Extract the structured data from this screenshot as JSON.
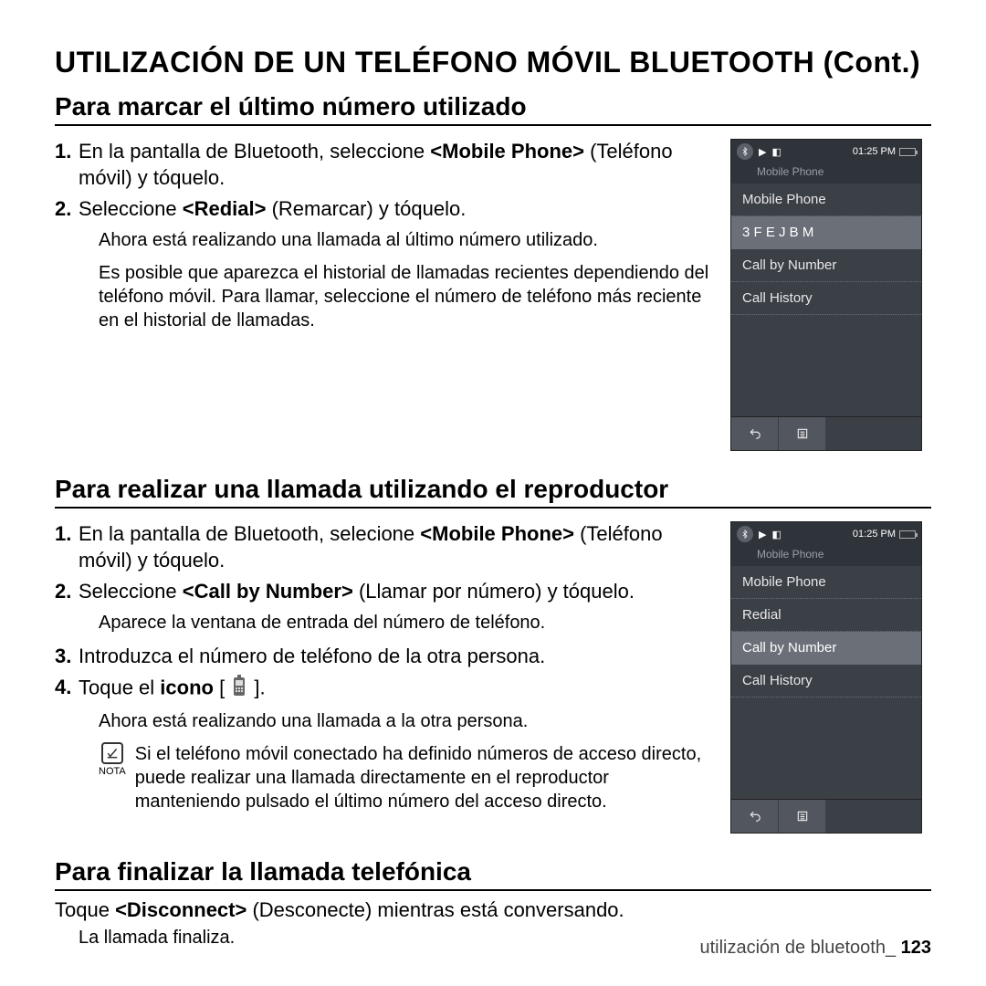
{
  "title": "UTILIZACIÓN DE UN TELÉFONO MÓVIL BLUETOOTH (Cont.)",
  "section1": {
    "heading": "Para marcar el último número utilizado",
    "step1_num": "1.",
    "step1_a": "En la pantalla de Bluetooth, seleccione ",
    "step1_b": "<Mobile Phone>",
    "step1_c": " (Teléfono móvil) y tóquelo.",
    "step2_num": "2.",
    "step2_a": "Seleccione ",
    "step2_b": "<Redial>",
    "step2_c": " (Remarcar) y tóquelo.",
    "sub1": "Ahora está realizando una llamada al último número utilizado.",
    "sub2": "Es posible que aparezca el historial de llamadas recientes dependiendo del teléfono móvil. Para llamar, seleccione el número de teléfono más reciente en el historial de llamadas."
  },
  "section2": {
    "heading": "Para realizar una llamada utilizando el reproductor",
    "step1_num": "1.",
    "step1_a": "En la pantalla de Bluetooth, selecione ",
    "step1_b": "<Mobile Phone>",
    "step1_c": " (Teléfono móvil) y tóquelo.",
    "step2_num": "2.",
    "step2_a": "Seleccione ",
    "step2_b": "<Call by Number>",
    "step2_c": " (Llamar por número) y tóquelo.",
    "sub1": "Aparece la ventana de entrada del número de teléfono.",
    "step3_num": "3.",
    "step3": "Introduzca el número de teléfono de la otra persona.",
    "step4_num": "4.",
    "step4_a": "Toque el ",
    "step4_b": "icono",
    "step4_c": " [ ",
    "step4_d": " ].",
    "sub2": "Ahora está realizando una llamada a la otra persona.",
    "note_label": "NOTA",
    "note": "Si el teléfono móvil conectado ha deﬁnido números de acceso directo, puede realizar una llamada directamente en el reproductor manteniendo pulsado el último número del acceso directo."
  },
  "section3": {
    "heading": "Para ﬁnalizar la llamada telefónica",
    "line_a": "Toque ",
    "line_b": "<Disconnect>",
    "line_c": " (Desconecte) mientras está conversando.",
    "sub": "La llamada ﬁnaliza."
  },
  "footer": {
    "text": "utilización de bluetooth_ ",
    "page": "123"
  },
  "phone1": {
    "time": "01:25 PM",
    "breadcrumb": "Mobile Phone",
    "items": [
      "Mobile Phone",
      "3 F E J B M",
      "Call by Number",
      "Call History"
    ],
    "selected": 1
  },
  "phone2": {
    "time": "01:25 PM",
    "breadcrumb": "Mobile Phone",
    "items": [
      "Mobile Phone",
      "Redial",
      "Call by Number",
      "Call History"
    ],
    "selected": 2
  }
}
